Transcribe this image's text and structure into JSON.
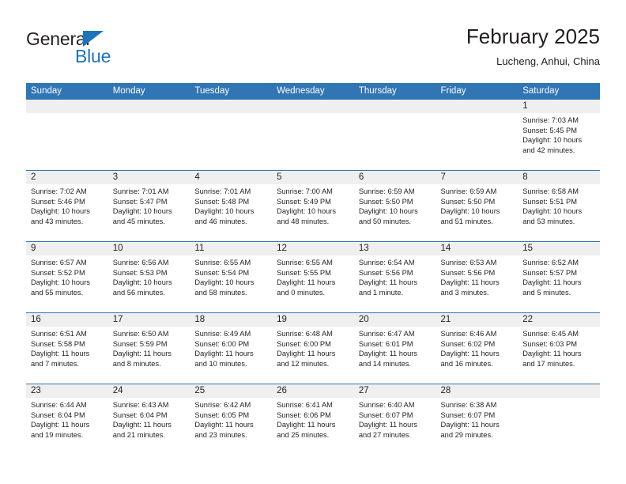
{
  "logo": {
    "word_top": "General",
    "word_bottom": "Blue",
    "triangle_color": "#1c74bb",
    "text_color": "#231f20"
  },
  "header": {
    "title": "February 2025",
    "subtitle": "Lucheng, Anhui, China"
  },
  "theme": {
    "header_blue": "#3075b4",
    "daynum_band": "#efefef",
    "text": "#231f20",
    "page_background": "#ffffff"
  },
  "weekday_headers": [
    "Sunday",
    "Monday",
    "Tuesday",
    "Wednesday",
    "Thursday",
    "Friday",
    "Saturday"
  ],
  "labels": {
    "sunrise_prefix": "Sunrise:",
    "sunset_prefix": "Sunset:",
    "daylight_prefix": "Daylight:"
  },
  "weeks": [
    [
      {
        "day": "",
        "sunrise": "",
        "sunset": "",
        "daylight_line1": "",
        "daylight_line2": ""
      },
      {
        "day": "",
        "sunrise": "",
        "sunset": "",
        "daylight_line1": "",
        "daylight_line2": ""
      },
      {
        "day": "",
        "sunrise": "",
        "sunset": "",
        "daylight_line1": "",
        "daylight_line2": ""
      },
      {
        "day": "",
        "sunrise": "",
        "sunset": "",
        "daylight_line1": "",
        "daylight_line2": ""
      },
      {
        "day": "",
        "sunrise": "",
        "sunset": "",
        "daylight_line1": "",
        "daylight_line2": ""
      },
      {
        "day": "",
        "sunrise": "",
        "sunset": "",
        "daylight_line1": "",
        "daylight_line2": ""
      },
      {
        "day": "1",
        "sunrise": "Sunrise: 7:03 AM",
        "sunset": "Sunset: 5:45 PM",
        "daylight_line1": "Daylight: 10 hours",
        "daylight_line2": "and 42 minutes."
      }
    ],
    [
      {
        "day": "2",
        "sunrise": "Sunrise: 7:02 AM",
        "sunset": "Sunset: 5:46 PM",
        "daylight_line1": "Daylight: 10 hours",
        "daylight_line2": "and 43 minutes."
      },
      {
        "day": "3",
        "sunrise": "Sunrise: 7:01 AM",
        "sunset": "Sunset: 5:47 PM",
        "daylight_line1": "Daylight: 10 hours",
        "daylight_line2": "and 45 minutes."
      },
      {
        "day": "4",
        "sunrise": "Sunrise: 7:01 AM",
        "sunset": "Sunset: 5:48 PM",
        "daylight_line1": "Daylight: 10 hours",
        "daylight_line2": "and 46 minutes."
      },
      {
        "day": "5",
        "sunrise": "Sunrise: 7:00 AM",
        "sunset": "Sunset: 5:49 PM",
        "daylight_line1": "Daylight: 10 hours",
        "daylight_line2": "and 48 minutes."
      },
      {
        "day": "6",
        "sunrise": "Sunrise: 6:59 AM",
        "sunset": "Sunset: 5:50 PM",
        "daylight_line1": "Daylight: 10 hours",
        "daylight_line2": "and 50 minutes."
      },
      {
        "day": "7",
        "sunrise": "Sunrise: 6:59 AM",
        "sunset": "Sunset: 5:50 PM",
        "daylight_line1": "Daylight: 10 hours",
        "daylight_line2": "and 51 minutes."
      },
      {
        "day": "8",
        "sunrise": "Sunrise: 6:58 AM",
        "sunset": "Sunset: 5:51 PM",
        "daylight_line1": "Daylight: 10 hours",
        "daylight_line2": "and 53 minutes."
      }
    ],
    [
      {
        "day": "9",
        "sunrise": "Sunrise: 6:57 AM",
        "sunset": "Sunset: 5:52 PM",
        "daylight_line1": "Daylight: 10 hours",
        "daylight_line2": "and 55 minutes."
      },
      {
        "day": "10",
        "sunrise": "Sunrise: 6:56 AM",
        "sunset": "Sunset: 5:53 PM",
        "daylight_line1": "Daylight: 10 hours",
        "daylight_line2": "and 56 minutes."
      },
      {
        "day": "11",
        "sunrise": "Sunrise: 6:55 AM",
        "sunset": "Sunset: 5:54 PM",
        "daylight_line1": "Daylight: 10 hours",
        "daylight_line2": "and 58 minutes."
      },
      {
        "day": "12",
        "sunrise": "Sunrise: 6:55 AM",
        "sunset": "Sunset: 5:55 PM",
        "daylight_line1": "Daylight: 11 hours",
        "daylight_line2": "and 0 minutes."
      },
      {
        "day": "13",
        "sunrise": "Sunrise: 6:54 AM",
        "sunset": "Sunset: 5:56 PM",
        "daylight_line1": "Daylight: 11 hours",
        "daylight_line2": "and 1 minute."
      },
      {
        "day": "14",
        "sunrise": "Sunrise: 6:53 AM",
        "sunset": "Sunset: 5:56 PM",
        "daylight_line1": "Daylight: 11 hours",
        "daylight_line2": "and 3 minutes."
      },
      {
        "day": "15",
        "sunrise": "Sunrise: 6:52 AM",
        "sunset": "Sunset: 5:57 PM",
        "daylight_line1": "Daylight: 11 hours",
        "daylight_line2": "and 5 minutes."
      }
    ],
    [
      {
        "day": "16",
        "sunrise": "Sunrise: 6:51 AM",
        "sunset": "Sunset: 5:58 PM",
        "daylight_line1": "Daylight: 11 hours",
        "daylight_line2": "and 7 minutes."
      },
      {
        "day": "17",
        "sunrise": "Sunrise: 6:50 AM",
        "sunset": "Sunset: 5:59 PM",
        "daylight_line1": "Daylight: 11 hours",
        "daylight_line2": "and 8 minutes."
      },
      {
        "day": "18",
        "sunrise": "Sunrise: 6:49 AM",
        "sunset": "Sunset: 6:00 PM",
        "daylight_line1": "Daylight: 11 hours",
        "daylight_line2": "and 10 minutes."
      },
      {
        "day": "19",
        "sunrise": "Sunrise: 6:48 AM",
        "sunset": "Sunset: 6:00 PM",
        "daylight_line1": "Daylight: 11 hours",
        "daylight_line2": "and 12 minutes."
      },
      {
        "day": "20",
        "sunrise": "Sunrise: 6:47 AM",
        "sunset": "Sunset: 6:01 PM",
        "daylight_line1": "Daylight: 11 hours",
        "daylight_line2": "and 14 minutes."
      },
      {
        "day": "21",
        "sunrise": "Sunrise: 6:46 AM",
        "sunset": "Sunset: 6:02 PM",
        "daylight_line1": "Daylight: 11 hours",
        "daylight_line2": "and 16 minutes."
      },
      {
        "day": "22",
        "sunrise": "Sunrise: 6:45 AM",
        "sunset": "Sunset: 6:03 PM",
        "daylight_line1": "Daylight: 11 hours",
        "daylight_line2": "and 17 minutes."
      }
    ],
    [
      {
        "day": "23",
        "sunrise": "Sunrise: 6:44 AM",
        "sunset": "Sunset: 6:04 PM",
        "daylight_line1": "Daylight: 11 hours",
        "daylight_line2": "and 19 minutes."
      },
      {
        "day": "24",
        "sunrise": "Sunrise: 6:43 AM",
        "sunset": "Sunset: 6:04 PM",
        "daylight_line1": "Daylight: 11 hours",
        "daylight_line2": "and 21 minutes."
      },
      {
        "day": "25",
        "sunrise": "Sunrise: 6:42 AM",
        "sunset": "Sunset: 6:05 PM",
        "daylight_line1": "Daylight: 11 hours",
        "daylight_line2": "and 23 minutes."
      },
      {
        "day": "26",
        "sunrise": "Sunrise: 6:41 AM",
        "sunset": "Sunset: 6:06 PM",
        "daylight_line1": "Daylight: 11 hours",
        "daylight_line2": "and 25 minutes."
      },
      {
        "day": "27",
        "sunrise": "Sunrise: 6:40 AM",
        "sunset": "Sunset: 6:07 PM",
        "daylight_line1": "Daylight: 11 hours",
        "daylight_line2": "and 27 minutes."
      },
      {
        "day": "28",
        "sunrise": "Sunrise: 6:38 AM",
        "sunset": "Sunset: 6:07 PM",
        "daylight_line1": "Daylight: 11 hours",
        "daylight_line2": "and 29 minutes."
      },
      {
        "day": "",
        "sunrise": "",
        "sunset": "",
        "daylight_line1": "",
        "daylight_line2": ""
      }
    ]
  ]
}
